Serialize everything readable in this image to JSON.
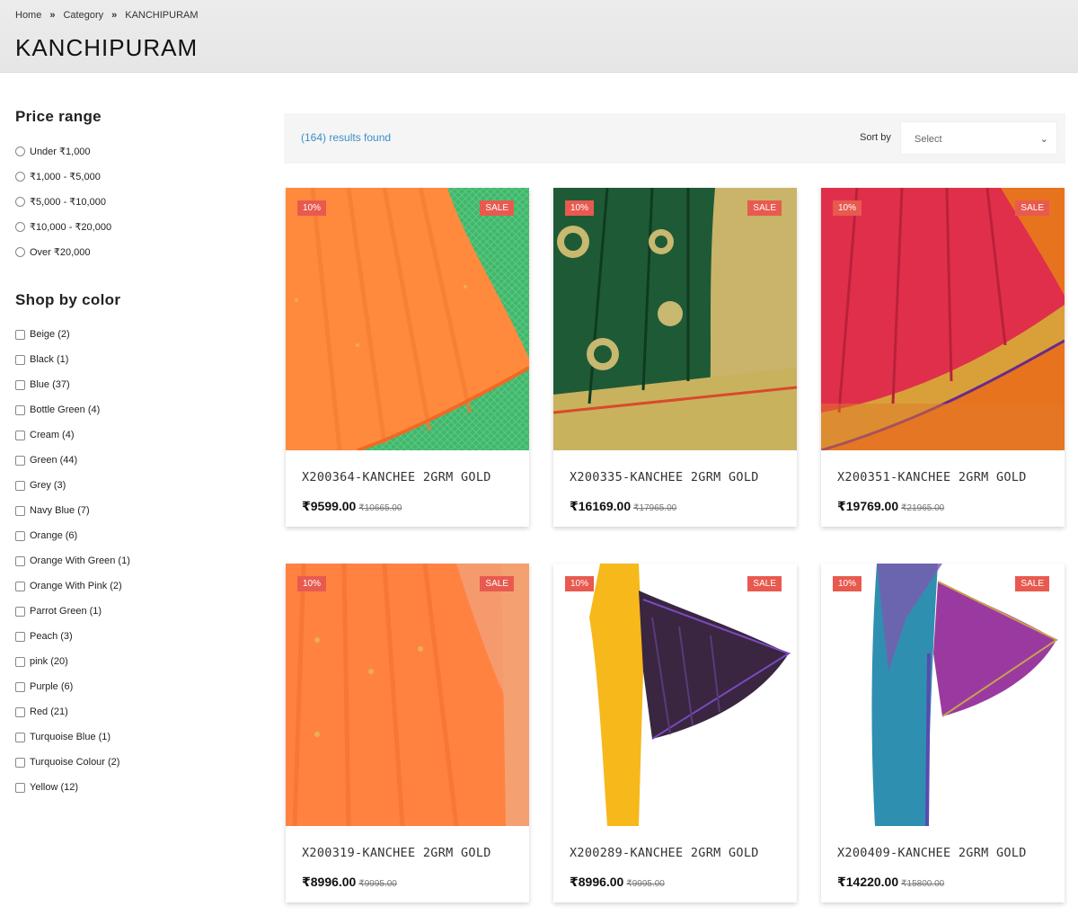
{
  "breadcrumb": [
    "Home",
    "Category",
    "KANCHIPURAM"
  ],
  "breadcrumb_separator": "»",
  "page_title": "KANCHIPURAM",
  "price_filter": {
    "title": "Price range",
    "options": [
      "Under ₹1,000",
      "₹1,000 - ₹5,000",
      "₹5,000 - ₹10,000",
      "₹10,000 - ₹20,000",
      "Over ₹20,000"
    ]
  },
  "color_filter": {
    "title": "Shop by color",
    "options": [
      "Beige (2)",
      "Black (1)",
      "Blue (37)",
      "Bottle Green (4)",
      "Cream (4)",
      "Green (44)",
      "Grey (3)",
      "Navy Blue (7)",
      "Orange (6)",
      "Orange With Green (1)",
      "Orange With Pink (2)",
      "Parrot Green (1)",
      "Peach (3)",
      "pink (20)",
      "Purple (6)",
      "Red (21)",
      "Turquoise Blue (1)",
      "Turquoise Colour (2)",
      "Yellow (12)"
    ]
  },
  "toolbar": {
    "results": "(164) results found",
    "sort_label": "Sort by",
    "sort_value": "Select"
  },
  "products": [
    {
      "name": "X200364-KANCHEE 2GRM GOLD",
      "price": "₹9599.00",
      "old_price": "₹10665.00",
      "discount": "10%",
      "sale": "SALE",
      "image": "orange-green-saree"
    },
    {
      "name": "X200335-KANCHEE 2GRM GOLD",
      "price": "₹16169.00",
      "old_price": "₹17965.00",
      "discount": "10%",
      "sale": "SALE",
      "image": "green-gold-saree"
    },
    {
      "name": "X200351-KANCHEE 2GRM GOLD",
      "price": "₹19769.00",
      "old_price": "₹21965.00",
      "discount": "10%",
      "sale": "SALE",
      "image": "pink-orange-saree"
    },
    {
      "name": "X200319-KANCHEE 2GRM GOLD",
      "price": "₹8996.00",
      "old_price": "₹9995.00",
      "discount": "10%",
      "sale": "SALE",
      "image": "orange-peach-saree"
    },
    {
      "name": "X200289-KANCHEE 2GRM GOLD",
      "price": "₹8996.00",
      "old_price": "₹9995.00",
      "discount": "10%",
      "sale": "SALE",
      "image": "yellow-purple-saree"
    },
    {
      "name": "X200409-KANCHEE 2GRM GOLD",
      "price": "₹14220.00",
      "old_price": "₹15800.00",
      "discount": "10%",
      "sale": "SALE",
      "image": "blue-purple-saree"
    }
  ],
  "colors": {
    "badge": "#e85a4f",
    "results_link": "#3a8fc8"
  }
}
